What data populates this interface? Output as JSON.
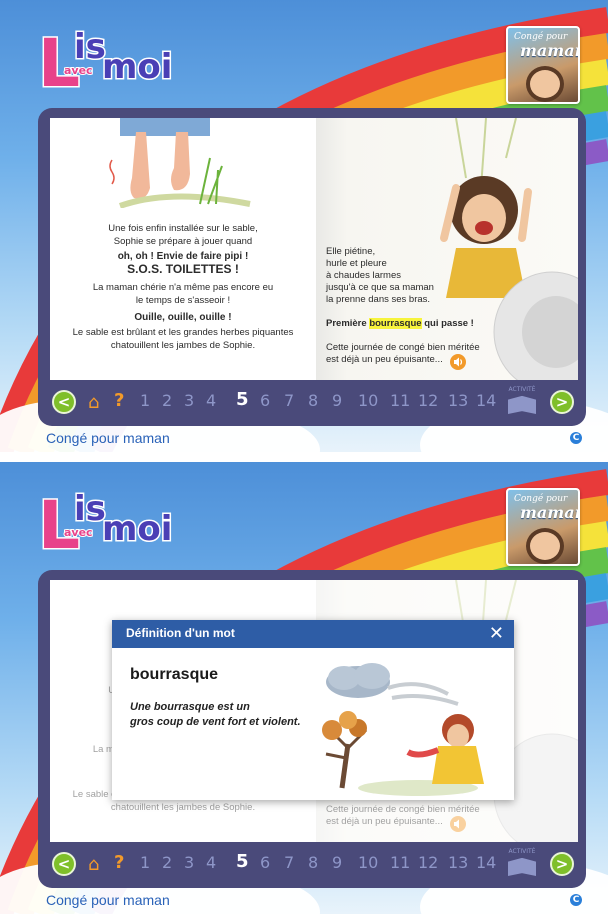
{
  "logo": {
    "main": "is",
    "letter": "L",
    "small": "avec",
    "end": "moi"
  },
  "cover": {
    "line1": "Congé pour",
    "line2": "maman"
  },
  "left_page": {
    "lines": [
      "Une fois enfin installée sur le sable,",
      "Sophie se prépare à jouer quand",
      "oh, oh ! Envie de faire pipi !",
      "S.O.S. TOILETTES !",
      "La maman chérie n'a même pas encore eu",
      "le temps de s'asseoir !",
      "Ouille, ouille, ouille !",
      "Le sable est brûlant et les grandes herbes piquantes",
      "chatouillent les jambes de Sophie."
    ]
  },
  "right_page": {
    "verse": [
      "Elle piétine,",
      "hurle et pleure",
      "à chaudes larmes",
      "jusqu'à ce que sa maman",
      "la prenne dans ses bras."
    ],
    "highlight_before": "Première ",
    "highlight_word": "bourrasque",
    "highlight_after": " qui passe !",
    "end": [
      "Cette journée de congé bien méritée",
      "est déjà un peu épuisante..."
    ]
  },
  "nav": {
    "prev": "<",
    "next": ">",
    "help": "?",
    "pages": [
      "1",
      "2",
      "3",
      "4",
      "5",
      "6",
      "7",
      "8",
      "9",
      "10",
      "11",
      "12",
      "13",
      "14"
    ],
    "current_page": "5",
    "activity_label": "ACTIVITÉ"
  },
  "footer": {
    "title": "Congé pour maman",
    "copyright": "C"
  },
  "popup": {
    "header": "Définition d'un mot",
    "close": "✕",
    "word": "bourrasque",
    "definition": [
      "Une bourrasque est un",
      "gros coup de vent fort et violent."
    ]
  },
  "colors": {
    "frame": "#4a4a7a",
    "nav_arrow": "#7fbf2a",
    "home_icon": "#f29a2a",
    "page_number": "#8e96c8",
    "popup_header": "#2e5da6",
    "highlight": "#f7f43c",
    "footer_title": "#2a62b8"
  }
}
